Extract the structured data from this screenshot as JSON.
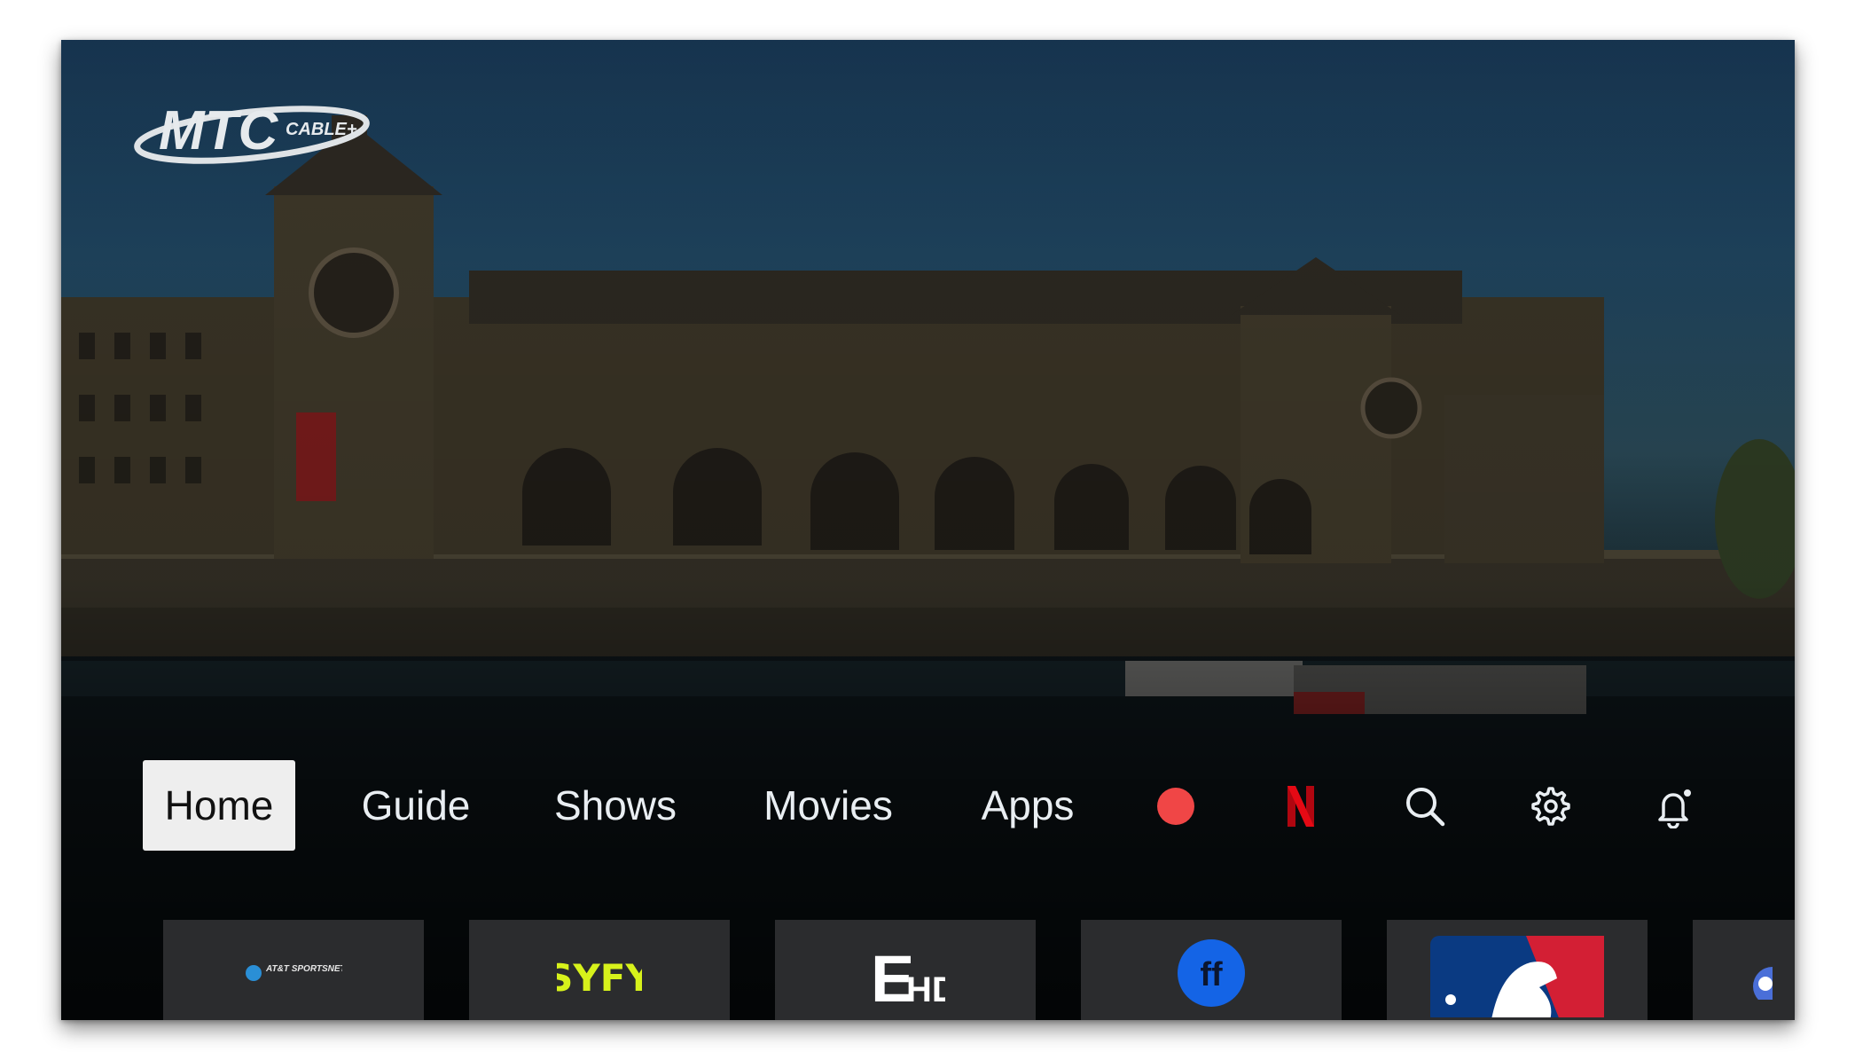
{
  "brand": {
    "logo_text": "MTC",
    "logo_sub": "CABLE+"
  },
  "nav": {
    "tabs": [
      {
        "label": "Home",
        "active": true
      },
      {
        "label": "Guide",
        "active": false
      },
      {
        "label": "Shows",
        "active": false
      },
      {
        "label": "Movies",
        "active": false
      },
      {
        "label": "Apps",
        "active": false
      }
    ],
    "icons": [
      "record-icon",
      "netflix-icon",
      "search-icon",
      "settings-icon",
      "notifications-icon"
    ]
  },
  "channels": [
    {
      "name": "AT&T SportsNet",
      "logo_text": "AT&T SPORTSNET"
    },
    {
      "name": "SYFY",
      "logo_text": "SYFY"
    },
    {
      "name": "E! HD",
      "logo_text": "HD"
    },
    {
      "name": "Freeform",
      "logo_text": "ff"
    },
    {
      "name": "MLB Network",
      "logo_text": ""
    },
    {
      "name": "partial-channel",
      "logo_text": ""
    }
  ],
  "colors": {
    "accent_record": "#f04646",
    "netflix_red": "#e50914",
    "syfy_yellow": "#d7f21b",
    "freeform_blue": "#1464e6",
    "mlb_blue": "#0a3a82",
    "mlb_red": "#d31f34"
  }
}
